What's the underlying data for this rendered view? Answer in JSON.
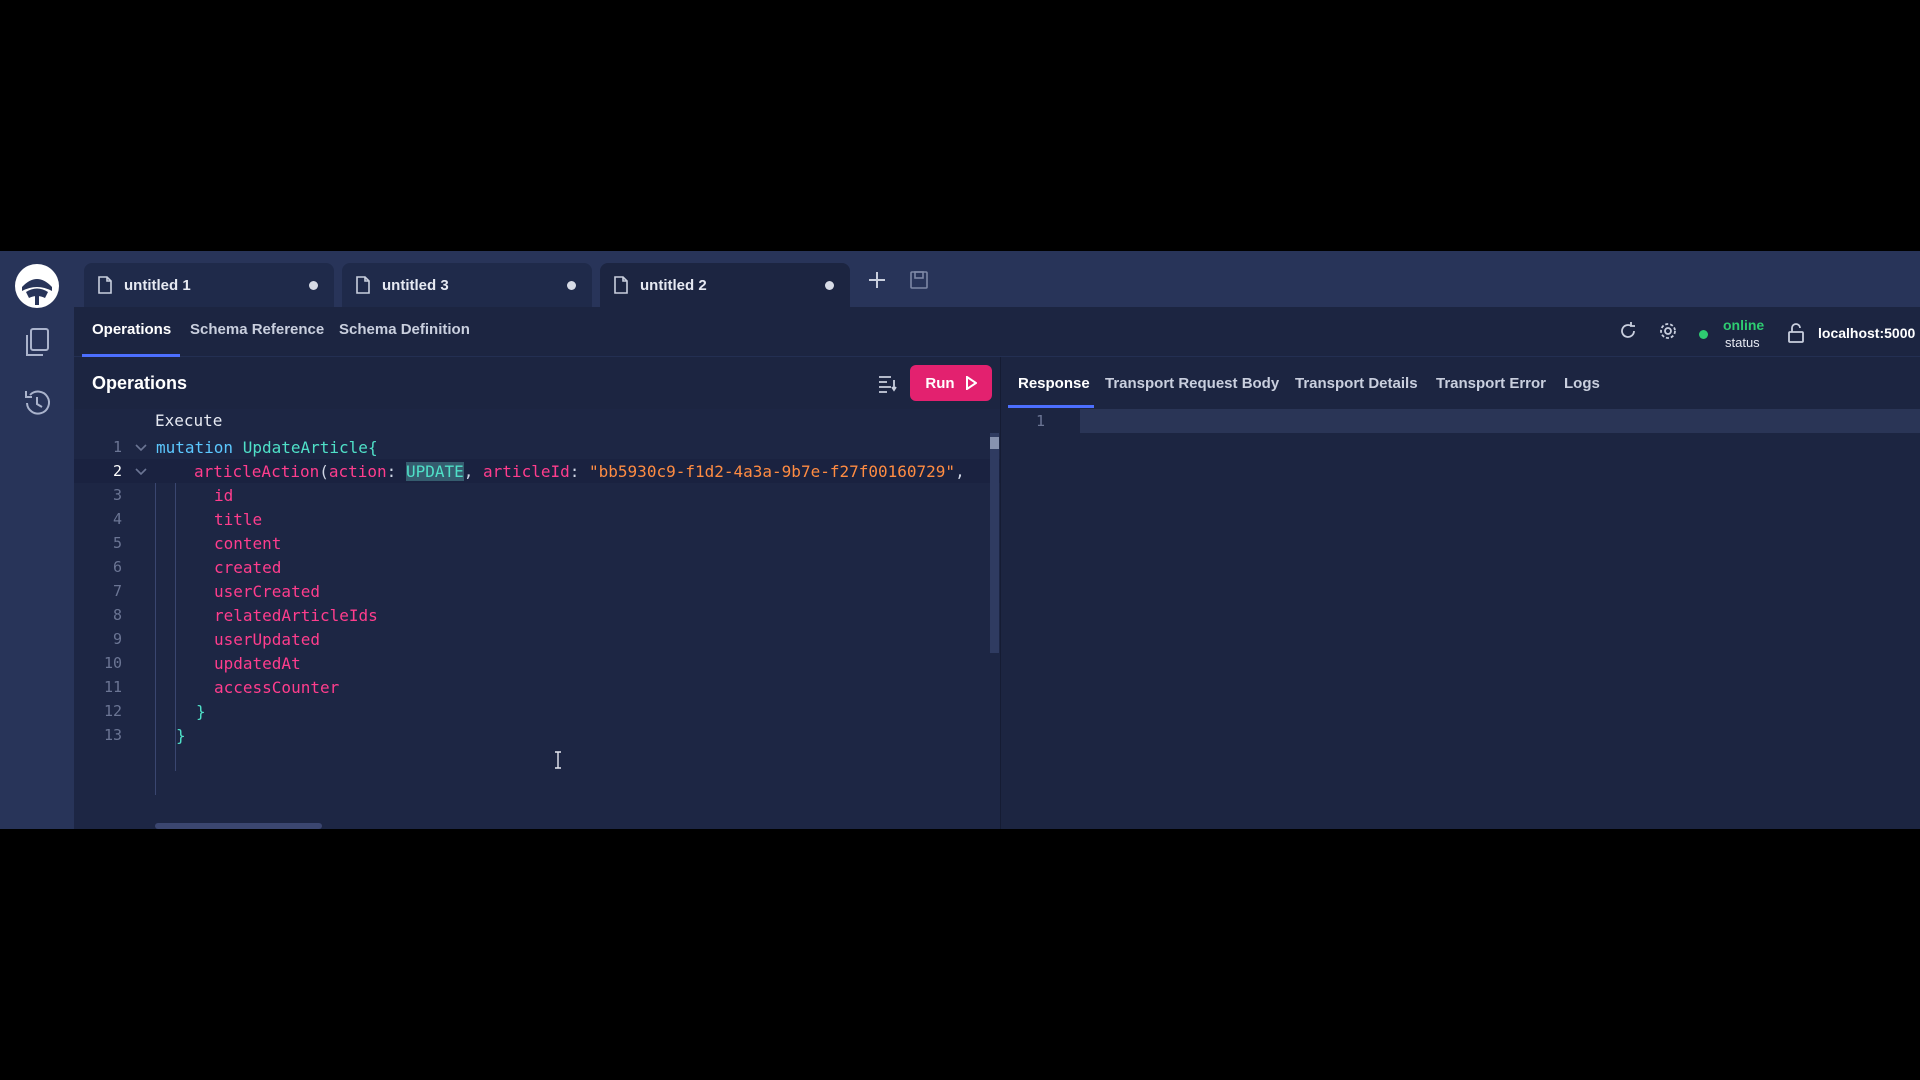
{
  "tabs": [
    {
      "label": "untitled 1",
      "active": false
    },
    {
      "label": "untitled 3",
      "active": false
    },
    {
      "label": "untitled 2",
      "active": true
    }
  ],
  "nav": {
    "operations": "Operations",
    "schema_reference": "Schema Reference",
    "schema_definition": "Schema Definition"
  },
  "status": {
    "state": "online",
    "label": "status",
    "endpoint": "localhost:5000"
  },
  "operations": {
    "title": "Operations",
    "run_label": "Run",
    "execute_lens": "Execute"
  },
  "editor": {
    "line_numbers": [
      "1",
      "2",
      "3",
      "4",
      "5",
      "6",
      "7",
      "8",
      "9",
      "10",
      "11",
      "12",
      "13"
    ],
    "keyword": "mutation",
    "operation_name": "UpdateArticle",
    "open_brace": "{",
    "close_brace": "}",
    "field_name": "articleAction",
    "open_paren": "(",
    "arg_action": "action",
    "colon": ":",
    "enum_value": "UPDATE",
    "comma": ",",
    "arg_article_id": "articleId",
    "article_id_value": "\"bb5930c9-f1d2-4a3a-9b7e-f27f00160729\"",
    "selections": [
      "id",
      "title",
      "content",
      "created",
      "userCreated",
      "relatedArticleIds",
      "userUpdated",
      "updatedAt",
      "accessCounter"
    ]
  },
  "response": {
    "tabs": [
      "Response",
      "Transport Request Body",
      "Transport Details",
      "Transport Error",
      "Logs"
    ],
    "line_number": "1"
  },
  "colors": {
    "accent": "#e3216f",
    "online": "#2ecc71",
    "background": "#1c2541",
    "tab_bar": "#283459"
  }
}
